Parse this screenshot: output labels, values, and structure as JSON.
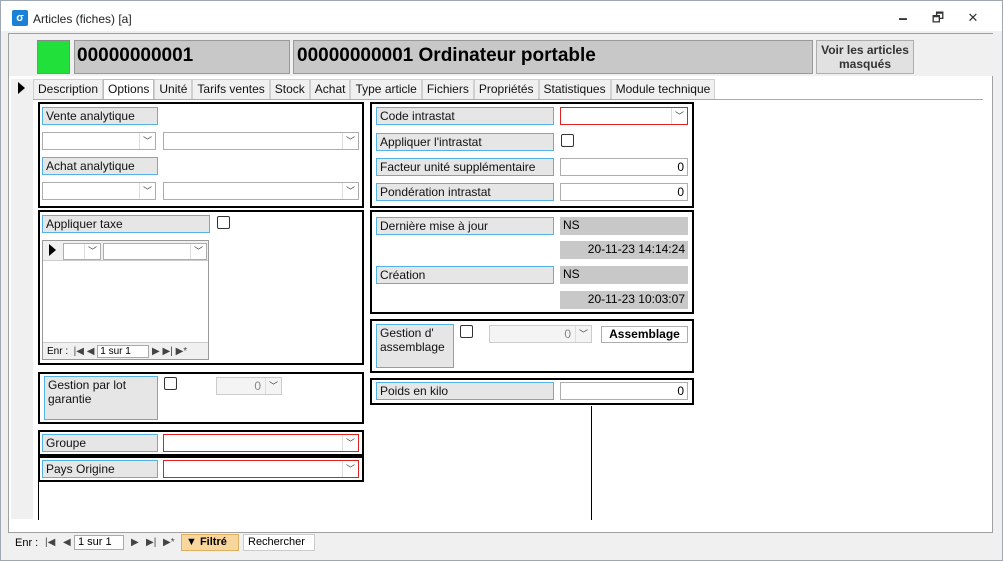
{
  "window": {
    "title": "Articles (fiches) [a]",
    "minimize": "🗕",
    "maximize": "🗗",
    "close": "✕"
  },
  "header": {
    "code": "00000000001",
    "name": "00000000001 Ordinateur portable",
    "button": "Voir les articles masqués",
    "status_color": "#22e03a"
  },
  "tabs": [
    "Description",
    "Options",
    "Unité",
    "Tarifs ventes",
    "Stock",
    "Achat",
    "Type article",
    "Fichiers",
    "Propriétés",
    "Statistiques",
    "Module technique"
  ],
  "active_tab": "Options",
  "left": {
    "vente_analytique": "Vente analytique",
    "achat_analytique": "Achat analytique",
    "appliquer_taxe": "Appliquer taxe",
    "subform_nav": {
      "label": "Enr :",
      "position": "1 sur 1"
    },
    "gestion_lot": "Gestion par lot garantie",
    "gestion_lot_value": "0",
    "groupe": "Groupe",
    "pays_origine": "Pays Origine"
  },
  "right": {
    "code_intrastat": "Code intrastat",
    "appliquer_intrastat": "Appliquer l'intrastat",
    "facteur": "Facteur unité supplémentaire",
    "facteur_value": "0",
    "ponderation": "Pondération intrastat",
    "ponderation_value": "0",
    "derniere_maj": "Dernière mise à jour",
    "derniere_maj_user": "NS",
    "derniere_maj_date": "20-11-23 14:14:24",
    "creation": "Création",
    "creation_user": "NS",
    "creation_date": "20-11-23 10:03:07",
    "gestion_assemblage": "Gestion d' assemblage",
    "assemblage_value": "0",
    "assemblage_button": "Assemblage",
    "poids": "Poids en kilo",
    "poids_value": "0"
  },
  "statusbar": {
    "label": "Enr :",
    "position": "1 sur 1",
    "filter": "Filtré",
    "search": "Rechercher"
  }
}
